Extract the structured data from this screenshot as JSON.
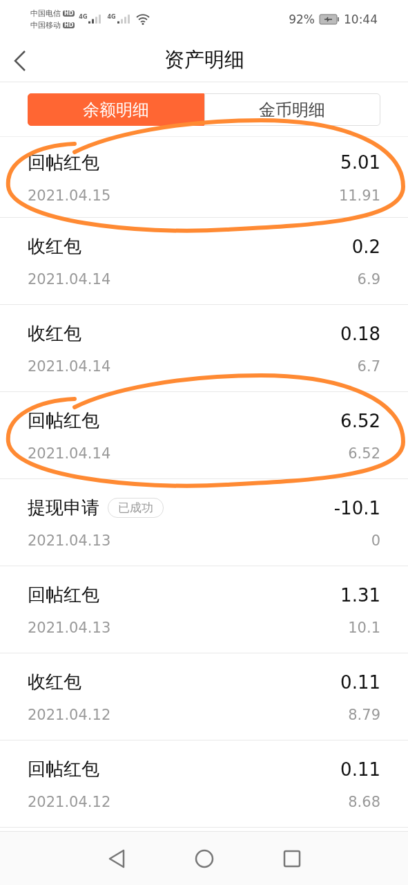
{
  "status_bar": {
    "carriers": [
      {
        "name": "中国电信",
        "badge": "HD"
      },
      {
        "name": "中国移动",
        "badge": "HD"
      }
    ],
    "networks": [
      "4G",
      "4G"
    ],
    "battery": "92%",
    "time": "10:44"
  },
  "header": {
    "title": "资产明细"
  },
  "tabs": [
    {
      "label": "余额明细",
      "selected": true
    },
    {
      "label": "金币明细",
      "selected": false
    }
  ],
  "records": [
    {
      "title": "回帖红包",
      "amount": "5.01",
      "date": "2021.04.15",
      "balance": "11.91",
      "circled": true
    },
    {
      "title": "收红包",
      "amount": "0.2",
      "date": "2021.04.14",
      "balance": "6.9",
      "circled": false
    },
    {
      "title": "收红包",
      "amount": "0.18",
      "date": "2021.04.14",
      "balance": "6.7",
      "circled": false
    },
    {
      "title": "回帖红包",
      "amount": "6.52",
      "date": "2021.04.14",
      "balance": "6.52",
      "circled": true
    },
    {
      "title": "提现申请",
      "status": "已成功",
      "amount": "-10.1",
      "date": "2021.04.13",
      "balance": "0",
      "circled": false
    },
    {
      "title": "回帖红包",
      "amount": "1.31",
      "date": "2021.04.13",
      "balance": "10.1",
      "circled": false
    },
    {
      "title": "收红包",
      "amount": "0.11",
      "date": "2021.04.12",
      "balance": "8.79",
      "circled": false
    },
    {
      "title": "回帖红包",
      "amount": "0.11",
      "date": "2021.04.12",
      "balance": "8.68",
      "circled": false
    }
  ]
}
